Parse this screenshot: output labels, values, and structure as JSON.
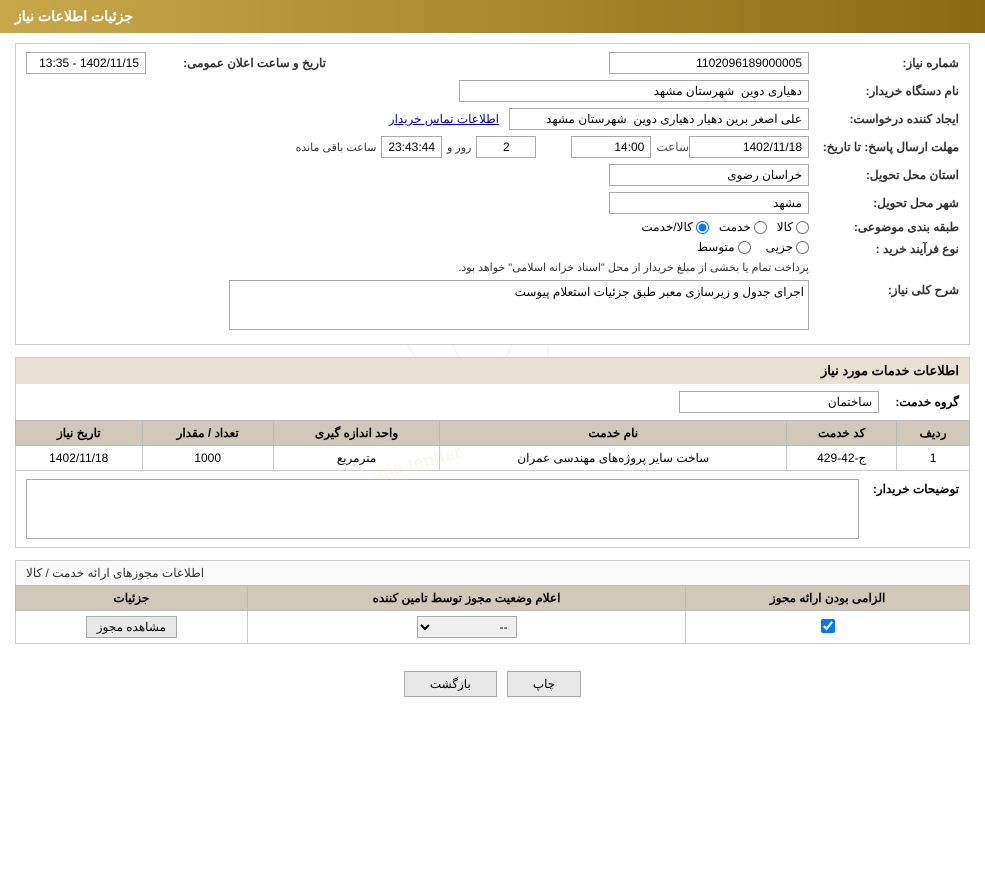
{
  "header": {
    "title": "جزئیات اطلاعات نیاز"
  },
  "form": {
    "need_number_label": "شماره نیاز:",
    "need_number_value": "1102096189000005",
    "buyer_org_label": "نام دستگاه خریدار:",
    "buyer_org_value": "دهیاری دوین  شهرستان مشهد",
    "creator_label": "ایجاد کننده درخواست:",
    "creator_value": "علی اصغر برین دهیار دهیاری دوین  شهرستان مشهد",
    "contact_link": "اطلاعات تماس خریدار",
    "deadline_label": "مهلت ارسال پاسخ: تا تاریخ:",
    "deadline_date": "1402/11/18",
    "deadline_time_label": "ساعت",
    "deadline_time": "14:00",
    "countdown_days": "2",
    "countdown_time": "23:43:44",
    "countdown_suffix": "ساعت باقی مانده",
    "countdown_days_label": "روز و",
    "province_label": "استان محل تحویل:",
    "province_value": "خراسان رضوی",
    "city_label": "شهر محل تحویل:",
    "city_value": "مشهد",
    "category_label": "طبقه بندی موضوعی:",
    "category_kala": "کالا",
    "category_khadamat": "خدمت",
    "category_kala_khadamat": "کالا/خدمت",
    "process_label": "نوع فرآیند خرید :",
    "process_jazei": "جزیی",
    "process_motovaset": "متوسط",
    "process_note": "پرداخت تمام یا بخشی از مبلغ خریدار از محل \"اسناد خزانه اسلامی\" خواهد بود.",
    "announce_datetime_label": "تاریخ و ساعت اعلان عمومی:",
    "announce_datetime_value": "1402/11/15 - 13:35",
    "description_label": "شرح کلی نیاز:",
    "description_value": "اجرای جدول و زیرسازی معبر طبق جزئیات استعلام پیوست"
  },
  "services": {
    "section_header": "اطلاعات خدمات مورد نیاز",
    "group_label": "گروه خدمت:",
    "group_value": "ساختمان",
    "table_headers": [
      "ردیف",
      "کد خدمت",
      "نام خدمت",
      "واحد اندازه گیری",
      "تعداد / مقدار",
      "تاریخ نیاز"
    ],
    "rows": [
      {
        "row": "1",
        "service_code": "ج-42-429",
        "service_name": "ساخت سایر پروژه‌های مهندسی عمران",
        "unit": "مترمربع",
        "quantity": "1000",
        "need_date": "1402/11/18"
      }
    ],
    "buyer_notes_label": "توضیحات خریدار:",
    "buyer_notes_value": ""
  },
  "license": {
    "section_header": "اطلاعات مجوزهای ارائه خدمت / کالا",
    "table_headers": [
      "الزامی بودن ارائه مجوز",
      "اعلام وضعیت مجوز توسط تامین کننده",
      "جزئیات"
    ],
    "rows": [
      {
        "required": true,
        "status": "--",
        "details_btn": "مشاهده مجوز"
      }
    ]
  },
  "buttons": {
    "print_label": "چاپ",
    "back_label": "بازگشت"
  }
}
